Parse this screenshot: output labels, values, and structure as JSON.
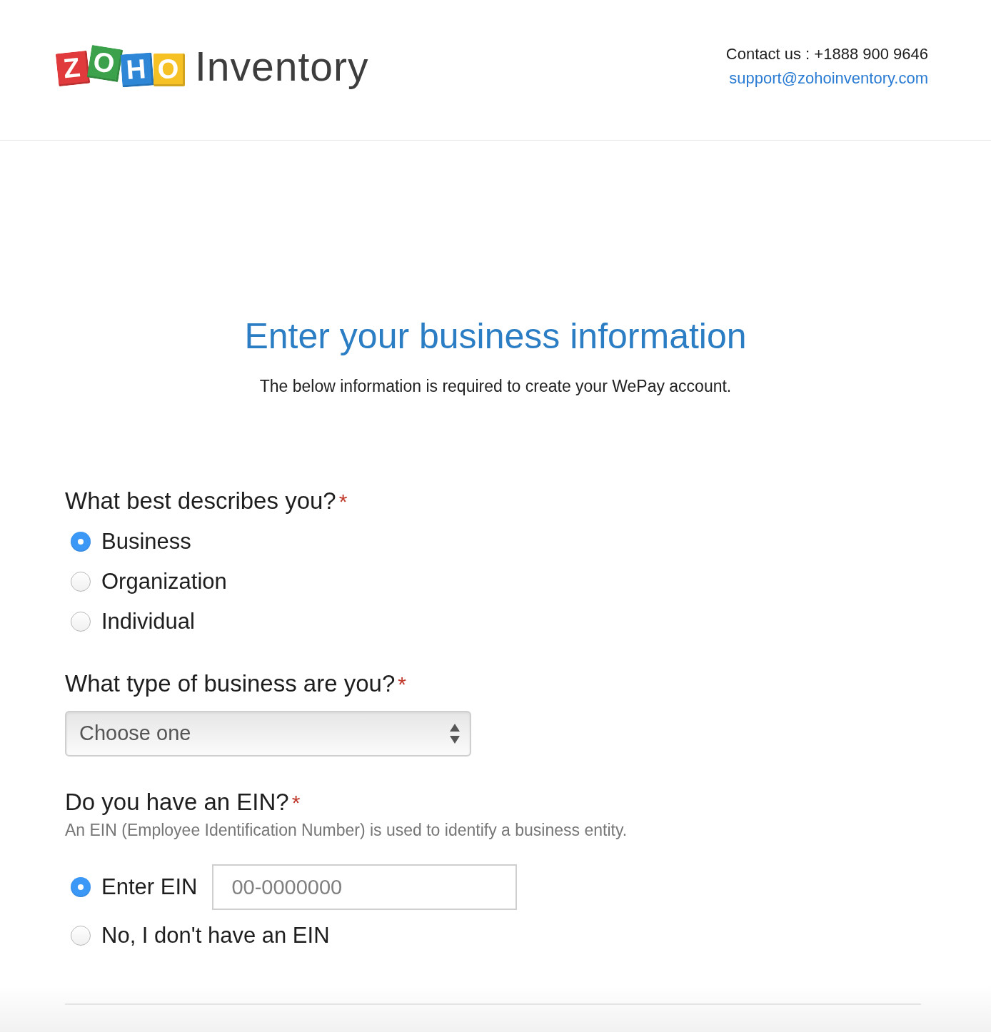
{
  "header": {
    "logo": {
      "tiles": [
        {
          "letter": "Z",
          "color": "#e03a3c"
        },
        {
          "letter": "O",
          "color": "#3ba24b"
        },
        {
          "letter": "H",
          "color": "#2d87d6"
        },
        {
          "letter": "O",
          "color": "#f6c125"
        }
      ],
      "product": "Inventory"
    },
    "contact": {
      "label": "Contact us : +1888 900 9646",
      "email": "support@zohoinventory.com"
    }
  },
  "title": "Enter your business information",
  "subtitle": "The below information is required to create your WePay account.",
  "questions": [
    {
      "kind": "radio",
      "label": "What best describes you?",
      "required_mark": "*",
      "options": [
        {
          "label": "Business",
          "selected": true
        },
        {
          "label": "Organization",
          "selected": false
        },
        {
          "label": "Individual",
          "selected": false
        }
      ]
    },
    {
      "kind": "select",
      "label": "What type of business are you?",
      "required_mark": "*",
      "select": {
        "value": "Choose one"
      }
    },
    {
      "kind": "ein",
      "label": "Do you have an EIN?",
      "required_mark": "*",
      "hint": "An EIN (Employee Identification Number) is used to identify a business entity.",
      "options": [
        {
          "label": "Enter EIN",
          "selected": true,
          "input": {
            "placeholder": "00-0000000"
          }
        },
        {
          "label": "No, I don't have an EIN",
          "selected": false
        }
      ]
    }
  ]
}
